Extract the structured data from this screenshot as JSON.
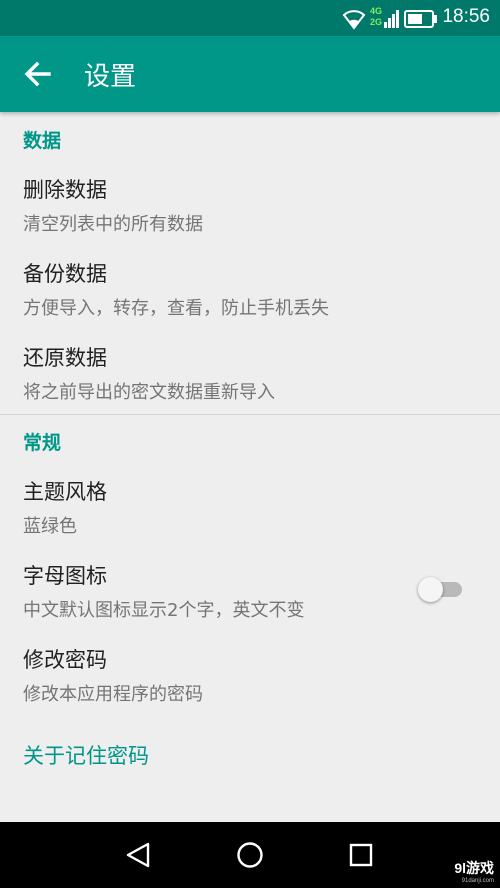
{
  "status_bar": {
    "time": "18:56",
    "network_top": "4G",
    "network_bottom": "2G",
    "icons": [
      "wifi-icon",
      "cell-signal-icon",
      "battery-icon"
    ]
  },
  "app_bar": {
    "title": "设置",
    "back_icon": "arrow-back-icon"
  },
  "sections": [
    {
      "header": "数据",
      "items": [
        {
          "title": "删除数据",
          "subtitle": "清空列表中的所有数据"
        },
        {
          "title": "备份数据",
          "subtitle": "方便导入，转存，查看，防止手机丢失"
        },
        {
          "title": "还原数据",
          "subtitle": "将之前导出的密文数据重新导入"
        }
      ]
    },
    {
      "header": "常规",
      "items": [
        {
          "title": "主题风格",
          "subtitle": "蓝绿色"
        },
        {
          "title": "字母图标",
          "subtitle": "中文默认图标显示2个字，英文不变",
          "toggle_on": false
        },
        {
          "title": "修改密码",
          "subtitle": "修改本应用程序的密码"
        }
      ]
    }
  ],
  "about_link": "关于记住密码",
  "nav_bar": {
    "icons": [
      "back-triangle-icon",
      "home-circle-icon",
      "recents-square-icon"
    ]
  },
  "watermark": {
    "brand": "9l游戏",
    "url": "91danji.com"
  },
  "colors": {
    "status_bar": "#00796b",
    "app_bar": "#009688",
    "accent": "#009688",
    "background": "#eeeeee",
    "nav_bar": "#000000"
  }
}
